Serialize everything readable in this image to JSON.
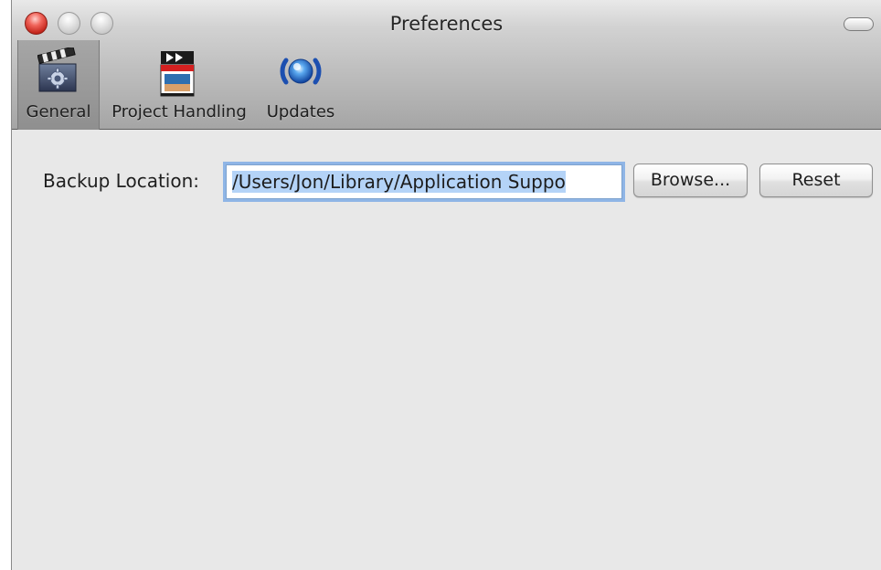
{
  "window": {
    "title": "Preferences"
  },
  "toolbar": {
    "items": [
      {
        "label": "General",
        "icon": "clapperboard-gear-icon",
        "selected": true
      },
      {
        "label": "Project Handling",
        "icon": "film-project-icon",
        "selected": false
      },
      {
        "label": "Updates",
        "icon": "updates-sync-icon",
        "selected": false
      }
    ]
  },
  "general": {
    "backup_location_label": "Backup Location:",
    "backup_location_value": "/Users/Jon/Library/Application Suppo",
    "browse_label": "Browse...",
    "reset_label": "Reset"
  },
  "colors": {
    "close_button": "#e0443a",
    "focus_ring": "#8fb5e6",
    "content_bg": "#e8e8e8"
  }
}
